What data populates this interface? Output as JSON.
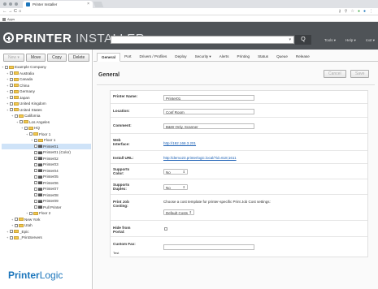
{
  "browser": {
    "tab_title": "Printer Installer",
    "tab_close": "×",
    "back": "←",
    "forward": "→",
    "reload": "C",
    "home": "⌂",
    "bookmark_apps": "Apps"
  },
  "header": {
    "logo_strong": "PRINTER",
    "logo_light": "INSTALLER",
    "search_button": "Q",
    "links": [
      "Tools ▾",
      "Help ▾",
      "root ▾"
    ]
  },
  "left": {
    "buttons": {
      "new": "New ▾",
      "move": "Move",
      "copy": "Copy",
      "delete": "Delete"
    },
    "tree": [
      {
        "label": "Example Company",
        "level": 0,
        "kind": "folder"
      },
      {
        "label": "Australia",
        "level": 1,
        "kind": "folder"
      },
      {
        "label": "Canada",
        "level": 1,
        "kind": "folder"
      },
      {
        "label": "China",
        "level": 1,
        "kind": "folder"
      },
      {
        "label": "Germany",
        "level": 1,
        "kind": "folder"
      },
      {
        "label": "Japan",
        "level": 1,
        "kind": "folder"
      },
      {
        "label": "United Kingdom",
        "level": 1,
        "kind": "folder"
      },
      {
        "label": "United States",
        "level": 1,
        "kind": "folder"
      },
      {
        "label": "California",
        "level": 2,
        "kind": "folder"
      },
      {
        "label": "Los Angeles",
        "level": 3,
        "kind": "folder"
      },
      {
        "label": "HQ",
        "level": 4,
        "kind": "folder"
      },
      {
        "label": "Floor 1",
        "level": 5,
        "kind": "folder"
      },
      {
        "label": "Floor 1",
        "level": 6,
        "kind": "folder"
      },
      {
        "label": "Printer01",
        "level": 6,
        "kind": "printer",
        "selected": true
      },
      {
        "label": "Printer01 (Color)",
        "level": 6,
        "kind": "printer"
      },
      {
        "label": "Printer02",
        "level": 6,
        "kind": "printer"
      },
      {
        "label": "Printer03",
        "level": 6,
        "kind": "printer"
      },
      {
        "label": "Printer04",
        "level": 6,
        "kind": "printer"
      },
      {
        "label": "Printer05",
        "level": 6,
        "kind": "printer"
      },
      {
        "label": "Printer06",
        "level": 6,
        "kind": "printer"
      },
      {
        "label": "Printer07",
        "level": 6,
        "kind": "printer"
      },
      {
        "label": "Printer08",
        "level": 6,
        "kind": "printer"
      },
      {
        "label": "Printer09",
        "level": 6,
        "kind": "printer"
      },
      {
        "label": "Pull Printer",
        "level": 6,
        "kind": "printer"
      },
      {
        "label": "Floor 2",
        "level": 5,
        "kind": "folder"
      },
      {
        "label": "New York",
        "level": 2,
        "kind": "folder"
      },
      {
        "label": "Utah",
        "level": 2,
        "kind": "folder"
      },
      {
        "label": "_Epic",
        "level": 1,
        "kind": "folder"
      },
      {
        "label": "_PrintServers",
        "level": 1,
        "kind": "folder"
      }
    ],
    "brand_strong": "Printer",
    "brand_light": "Logic"
  },
  "main": {
    "tabs": [
      "General",
      "Port",
      "Drivers / Profiles",
      "Deploy",
      "Security ▾",
      "Alerts",
      "Printing",
      "Status",
      "Queue",
      "Release"
    ],
    "active_tab": 0,
    "section_title": "General",
    "cancel": "Cancel",
    "save": "Save",
    "fields": {
      "printer_name_label": "Printer Name:",
      "printer_name_value": "Printer01",
      "location_label": "Location:",
      "location_value": "Conf Room",
      "comment_label": "Comment:",
      "comment_value": "B&W Only, Scanner",
      "web_label": "Web Interface:",
      "web_value": "http://192.168.3.201",
      "install_label": "Install URL:",
      "install_value": "http://demo23.printerlogic.local/?id=618;1611",
      "color_label": "Supports Color:",
      "color_value": "No",
      "duplex_label": "Supports Duplex:",
      "duplex_value": "No",
      "jobcost_label": "Print Job Costing:",
      "jobcost_text": "Choose a cost template for printer-specific Print Job Cost settings:",
      "jobcost_value": "Default Costs",
      "hide_label": "Hide from Portal:",
      "custom_label": "Custom Fax:",
      "custom_sub": "Test"
    }
  }
}
